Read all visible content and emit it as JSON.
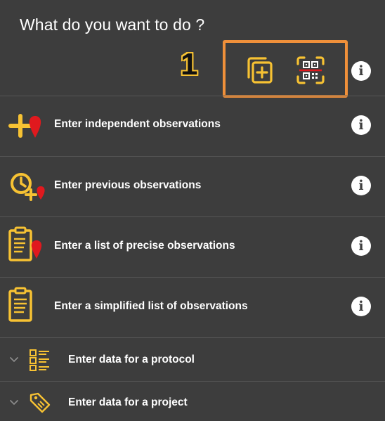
{
  "header": {
    "title": "What do you want to do ?",
    "annotation_number": "1"
  },
  "toolbar": {
    "buttons": [
      {
        "name": "add-copy-icon"
      },
      {
        "name": "qr-scan-icon"
      }
    ],
    "info_glyph": "i"
  },
  "menu": {
    "items": [
      {
        "label": "Enter independent observations",
        "icon": "plus-marker-icon",
        "info_glyph": "i"
      },
      {
        "label": "Enter previous observations",
        "icon": "clock-plus-marker-icon",
        "info_glyph": "i"
      },
      {
        "label": "Enter a list of precise observations",
        "icon": "clipboard-marker-icon",
        "info_glyph": "i"
      },
      {
        "label": "Enter a simplified list of observations",
        "icon": "clipboard-icon",
        "info_glyph": "i"
      }
    ],
    "expandables": [
      {
        "label": "Enter data for a protocol",
        "icon": "protocol-list-icon"
      },
      {
        "label": "Enter data for a project",
        "icon": "tag-icon"
      }
    ]
  },
  "colors": {
    "background": "#3d3d3d",
    "accent_yellow": "#f7c233",
    "marker_red": "#e0191e",
    "highlight_orange": "#f0903a",
    "divider": "#555555"
  }
}
